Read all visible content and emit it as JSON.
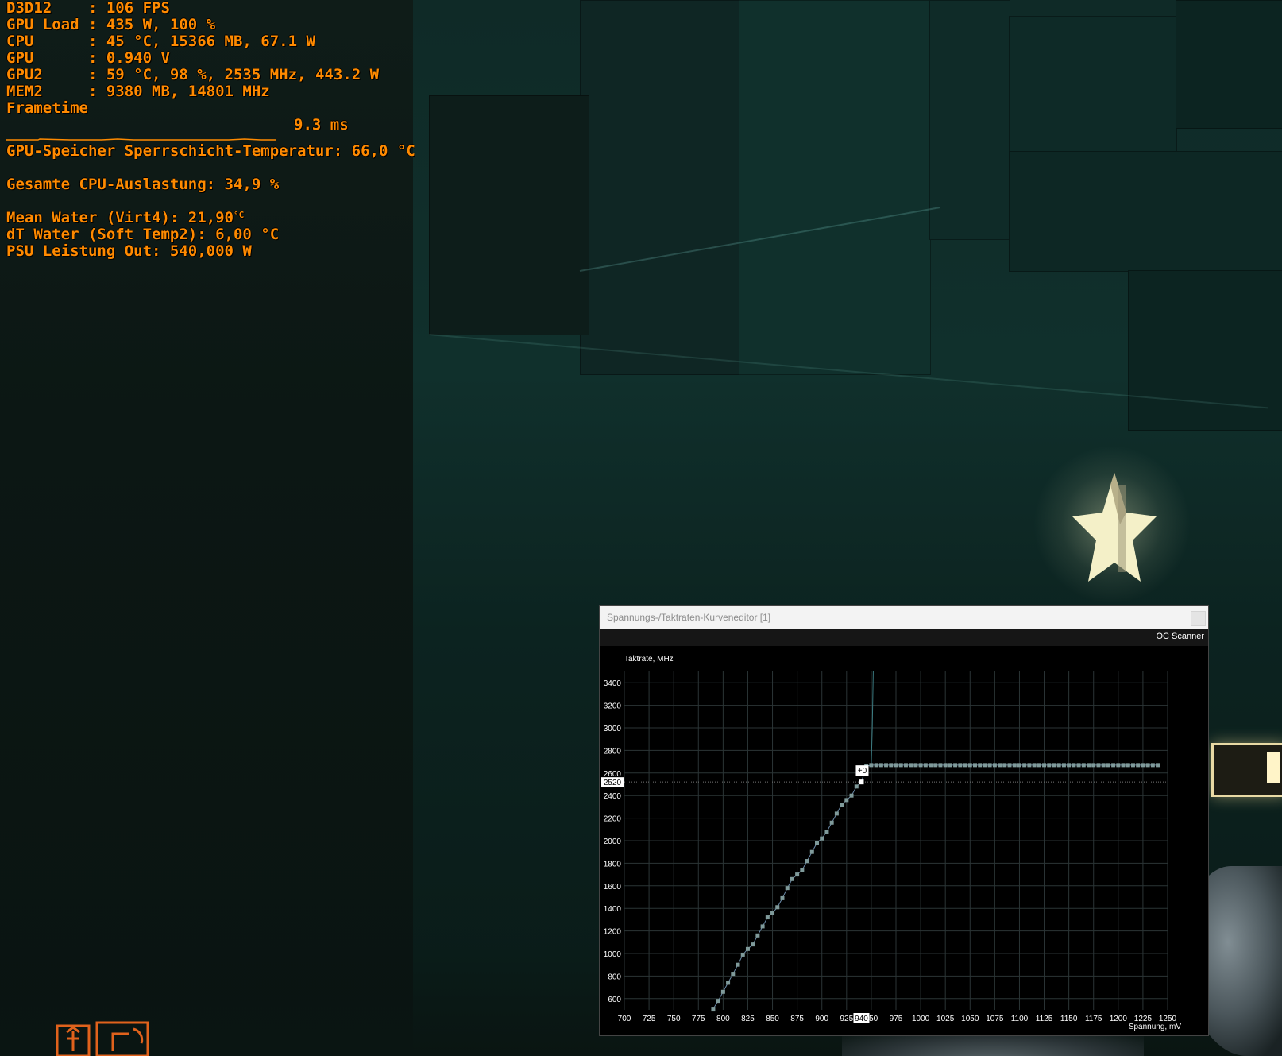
{
  "osd": {
    "rows": [
      {
        "label": "D3D12    ",
        "sep": ": ",
        "value": "106 FPS"
      },
      {
        "label": "GPU Load ",
        "sep": ": ",
        "value": "435 W, 100 %"
      },
      {
        "label": "CPU      ",
        "sep": ": ",
        "value": "45 °C, 15366 MB, 67.1 W"
      },
      {
        "label": "GPU      ",
        "sep": ": ",
        "value": "0.940 V"
      },
      {
        "label": "GPU2     ",
        "sep": ": ",
        "value": "59 °C, 98 %, 2535 MHz, 443.2 W"
      },
      {
        "label": "MEM2     ",
        "sep": ": ",
        "value": "9380 MB, 14801 MHz"
      }
    ],
    "frametime_label": "Frametime",
    "frametime_value": "9.3 ms",
    "mem_junction": "GPU-Speicher Sperrschicht-Temperatur: 66,0 °C",
    "cpu_usage": "Gesamte CPU-Auslastung: 34,9 %",
    "mean_water": "Mean Water (Virt4): 21,90",
    "mean_water_unit": "°C",
    "dt_water": "dT Water (Soft Temp2): 6,00 °C",
    "psu_out": "PSU Leistung Out: 540,000 W"
  },
  "window": {
    "title": "Spannungs-/Taktraten-Kurveneditor [1]",
    "oc_scanner_label": "OC Scanner"
  },
  "chart_data": {
    "type": "line",
    "ylabel": "Taktrate, MHz",
    "xlabel": "Spannung, mV",
    "xlim": [
      700,
      1250
    ],
    "ylim": [
      500,
      3500
    ],
    "x_ticks": [
      700,
      725,
      750,
      775,
      800,
      825,
      850,
      875,
      900,
      925,
      950,
      975,
      1000,
      1025,
      1050,
      1075,
      1100,
      1125,
      1150,
      1175,
      1200,
      1225,
      1250
    ],
    "y_ticks": [
      600,
      800,
      1000,
      1200,
      1400,
      1600,
      1800,
      2000,
      2200,
      2400,
      2600,
      2800,
      3000,
      3200,
      3400
    ],
    "selected_voltage": "940",
    "selected_clock": "2520",
    "offset_label": "+0",
    "colors": {
      "curve": "#6a8aa8",
      "points": "#7f9a9a",
      "grid": "#2b3536",
      "selected": "#ffffff"
    },
    "points": [
      {
        "x": 790,
        "y": 510
      },
      {
        "x": 795,
        "y": 580
      },
      {
        "x": 800,
        "y": 660
      },
      {
        "x": 805,
        "y": 740
      },
      {
        "x": 810,
        "y": 820
      },
      {
        "x": 815,
        "y": 900
      },
      {
        "x": 820,
        "y": 990
      },
      {
        "x": 825,
        "y": 1040
      },
      {
        "x": 830,
        "y": 1080
      },
      {
        "x": 835,
        "y": 1160
      },
      {
        "x": 840,
        "y": 1240
      },
      {
        "x": 845,
        "y": 1320
      },
      {
        "x": 850,
        "y": 1360
      },
      {
        "x": 855,
        "y": 1410
      },
      {
        "x": 860,
        "y": 1490
      },
      {
        "x": 865,
        "y": 1580
      },
      {
        "x": 870,
        "y": 1660
      },
      {
        "x": 875,
        "y": 1700
      },
      {
        "x": 880,
        "y": 1740
      },
      {
        "x": 885,
        "y": 1820
      },
      {
        "x": 890,
        "y": 1900
      },
      {
        "x": 895,
        "y": 1980
      },
      {
        "x": 900,
        "y": 2020
      },
      {
        "x": 905,
        "y": 2080
      },
      {
        "x": 910,
        "y": 2160
      },
      {
        "x": 915,
        "y": 2240
      },
      {
        "x": 920,
        "y": 2320
      },
      {
        "x": 925,
        "y": 2360
      },
      {
        "x": 930,
        "y": 2400
      },
      {
        "x": 935,
        "y": 2480
      },
      {
        "x": 940,
        "y": 2520
      },
      {
        "x": 945,
        "y": 2660
      },
      {
        "x": 950,
        "y": 2670
      },
      {
        "x": 955,
        "y": 2670
      },
      {
        "x": 960,
        "y": 2670
      },
      {
        "x": 965,
        "y": 2670
      },
      {
        "x": 970,
        "y": 2670
      },
      {
        "x": 975,
        "y": 2670
      },
      {
        "x": 980,
        "y": 2670
      },
      {
        "x": 985,
        "y": 2670
      },
      {
        "x": 990,
        "y": 2670
      },
      {
        "x": 995,
        "y": 2670
      },
      {
        "x": 1000,
        "y": 2670
      },
      {
        "x": 1005,
        "y": 2670
      },
      {
        "x": 1010,
        "y": 2670
      },
      {
        "x": 1015,
        "y": 2670
      },
      {
        "x": 1020,
        "y": 2670
      },
      {
        "x": 1025,
        "y": 2670
      },
      {
        "x": 1030,
        "y": 2670
      },
      {
        "x": 1035,
        "y": 2670
      },
      {
        "x": 1040,
        "y": 2670
      },
      {
        "x": 1045,
        "y": 2670
      },
      {
        "x": 1050,
        "y": 2670
      },
      {
        "x": 1055,
        "y": 2670
      },
      {
        "x": 1060,
        "y": 2670
      },
      {
        "x": 1065,
        "y": 2670
      },
      {
        "x": 1070,
        "y": 2670
      },
      {
        "x": 1075,
        "y": 2670
      },
      {
        "x": 1080,
        "y": 2670
      },
      {
        "x": 1085,
        "y": 2670
      },
      {
        "x": 1090,
        "y": 2670
      },
      {
        "x": 1095,
        "y": 2670
      },
      {
        "x": 1100,
        "y": 2670
      },
      {
        "x": 1105,
        "y": 2670
      },
      {
        "x": 1110,
        "y": 2670
      },
      {
        "x": 1115,
        "y": 2670
      },
      {
        "x": 1120,
        "y": 2670
      },
      {
        "x": 1125,
        "y": 2670
      },
      {
        "x": 1130,
        "y": 2670
      },
      {
        "x": 1135,
        "y": 2670
      },
      {
        "x": 1140,
        "y": 2670
      },
      {
        "x": 1145,
        "y": 2670
      },
      {
        "x": 1150,
        "y": 2670
      },
      {
        "x": 1155,
        "y": 2670
      },
      {
        "x": 1160,
        "y": 2670
      },
      {
        "x": 1165,
        "y": 2670
      },
      {
        "x": 1170,
        "y": 2670
      },
      {
        "x": 1175,
        "y": 2670
      },
      {
        "x": 1180,
        "y": 2670
      },
      {
        "x": 1185,
        "y": 2670
      },
      {
        "x": 1190,
        "y": 2670
      },
      {
        "x": 1195,
        "y": 2670
      },
      {
        "x": 1200,
        "y": 2670
      },
      {
        "x": 1205,
        "y": 2670
      },
      {
        "x": 1210,
        "y": 2670
      },
      {
        "x": 1215,
        "y": 2670
      },
      {
        "x": 1220,
        "y": 2670
      },
      {
        "x": 1225,
        "y": 2670
      },
      {
        "x": 1230,
        "y": 2670
      },
      {
        "x": 1235,
        "y": 2670
      },
      {
        "x": 1240,
        "y": 2670
      }
    ],
    "limit_line": [
      {
        "x": 950,
        "y": 2670
      },
      {
        "x": 951,
        "y": 3000
      },
      {
        "x": 952,
        "y": 3500
      }
    ]
  }
}
